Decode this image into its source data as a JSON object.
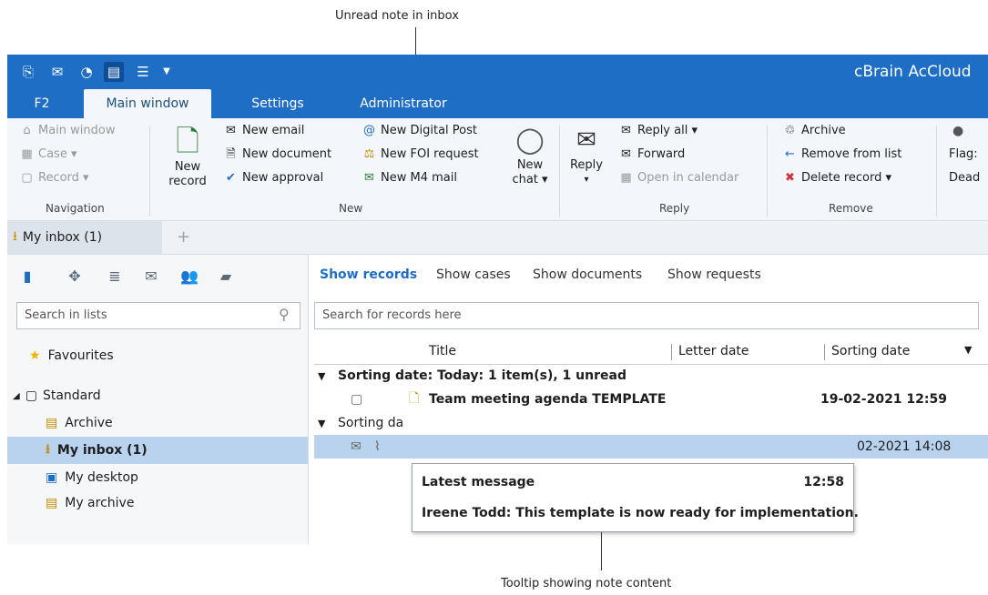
{
  "callouts": {
    "top": "Unread note in inbox",
    "bottom": "Tooltip showing note content"
  },
  "app": {
    "title": "cBrain AcCloud",
    "quick_access_icons": [
      "new-record-icon",
      "new-email-icon",
      "new-chat-icon",
      "view-mode-icon",
      "list-view-icon",
      "dropdown-icon"
    ]
  },
  "ribbon_tabs": [
    "F2",
    "Main window",
    "Settings",
    "Administrator"
  ],
  "ribbon": {
    "navigation": {
      "label": "Navigation",
      "items": [
        "Main window",
        "Case ▾",
        "Record ▾"
      ]
    },
    "new": {
      "label": "New",
      "big_button": [
        "New",
        "record"
      ],
      "items_col1": [
        "New email",
        "New document",
        "New approval"
      ],
      "items_col2": [
        "New Digital Post",
        "New FOI request",
        "New M4 mail"
      ],
      "chat_button": [
        "New",
        "chat ▾"
      ]
    },
    "reply": {
      "label": "Reply",
      "big_button": [
        "Reply",
        "▾"
      ],
      "items": [
        "Reply all ▾",
        "Forward",
        "Open in calendar"
      ]
    },
    "remove": {
      "label": "Remove",
      "items": [
        "Archive",
        "Remove from list",
        "Delete record ▾"
      ]
    },
    "flag": {
      "items": [
        "Flag:",
        "Dead"
      ]
    }
  },
  "doc_tabs": {
    "active": "My inbox (1)",
    "add": "+"
  },
  "left_pane": {
    "search_placeholder": "Search in lists",
    "favourites": "Favourites",
    "standard": "Standard",
    "items": [
      "Archive",
      "My inbox (1)",
      "My desktop",
      "My archive"
    ]
  },
  "main_pane": {
    "tabs": [
      "Show records",
      "Show cases",
      "Show documents",
      "Show requests"
    ],
    "search_placeholder": "Search for records here",
    "columns": [
      "Title",
      "Letter date",
      "Sorting date"
    ],
    "groups": [
      {
        "label": "Sorting date: Today: 1 item(s), 1 unread",
        "rows": [
          {
            "title": "Team meeting agenda TEMPLATE",
            "sorting_date": "19-02-2021 12:59"
          }
        ]
      },
      {
        "label": "Sorting da",
        "rows": [
          {
            "title": "",
            "sorting_date": "02-2021 14:08"
          }
        ]
      }
    ]
  },
  "tooltip": {
    "heading": "Latest message",
    "time": "12:58",
    "message": "Ireene Todd: This template is now ready for implementation."
  }
}
